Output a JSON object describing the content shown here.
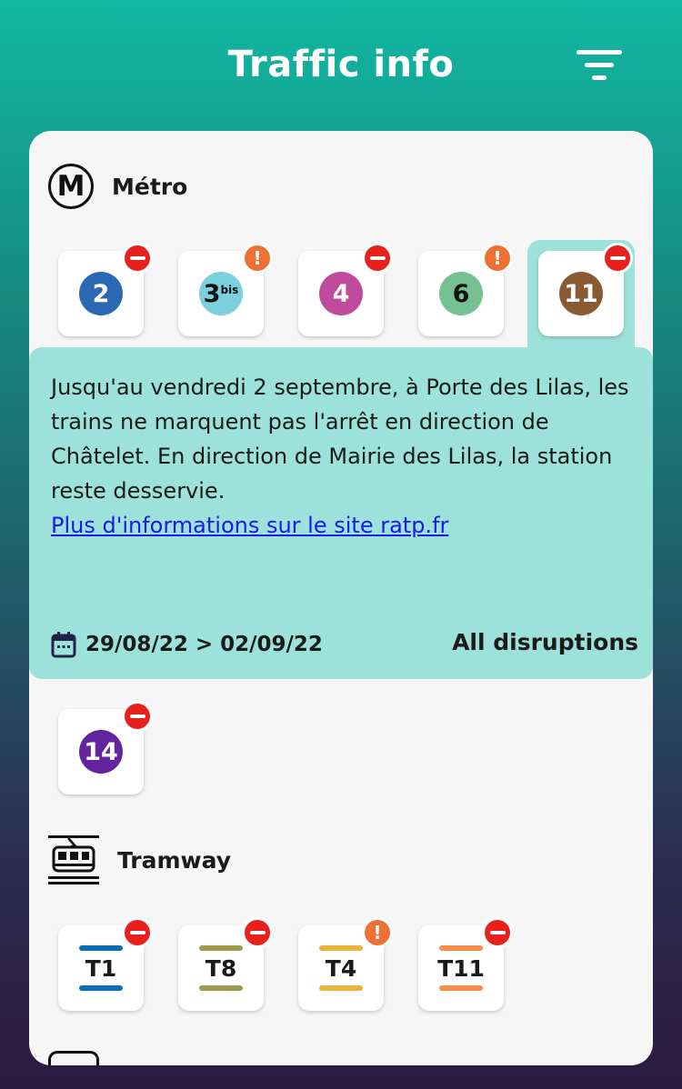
{
  "header": {
    "title": "Traffic info"
  },
  "metro": {
    "title": "Métro",
    "icon_letter": "M",
    "lines": [
      {
        "label": "2",
        "color": "#2b68b3",
        "text_color": "#ffffff",
        "status": "minus",
        "selected": false
      },
      {
        "label": "3",
        "sup": "bis",
        "color": "#7ccfdc",
        "text_color": "#111111",
        "status": "warn",
        "selected": false
      },
      {
        "label": "4",
        "color": "#c04b9d",
        "text_color": "#ffffff",
        "status": "minus",
        "selected": false
      },
      {
        "label": "6",
        "color": "#76c191",
        "text_color": "#111111",
        "status": "warn",
        "selected": false
      },
      {
        "label": "11",
        "color": "#8a5a33",
        "text_color": "#ffffff",
        "status": "minus",
        "selected": true
      }
    ],
    "extra_lines": [
      {
        "label": "14",
        "color": "#62259d",
        "text_color": "#ffffff",
        "status": "minus"
      }
    ]
  },
  "disruption": {
    "text": "Jusqu'au vendredi 2 septembre, à Porte des Lilas, les trains ne marquent pas l'arrêt en direction de Châtelet. En direction de Mairie des Lilas, la station reste desservie.",
    "link": "Plus d'informations sur le site ratp.fr",
    "dates": "29/08/22 > 02/09/22",
    "all_label": "All disruptions"
  },
  "tramway": {
    "title": "Tramway",
    "lines": [
      {
        "label": "T1",
        "color": "#0e6eb4",
        "status": "minus"
      },
      {
        "label": "T8",
        "color": "#9f9b4c",
        "status": "minus"
      },
      {
        "label": "T4",
        "color": "#ebb33b",
        "status": "warn"
      },
      {
        "label": "T11",
        "color": "#f68f4b",
        "status": "minus"
      }
    ]
  },
  "icons": {
    "filter": "filter-icon",
    "metro": "metro-icon",
    "tram": "tram-icon",
    "calendar": "calendar-icon",
    "warning_symbol": "!"
  }
}
